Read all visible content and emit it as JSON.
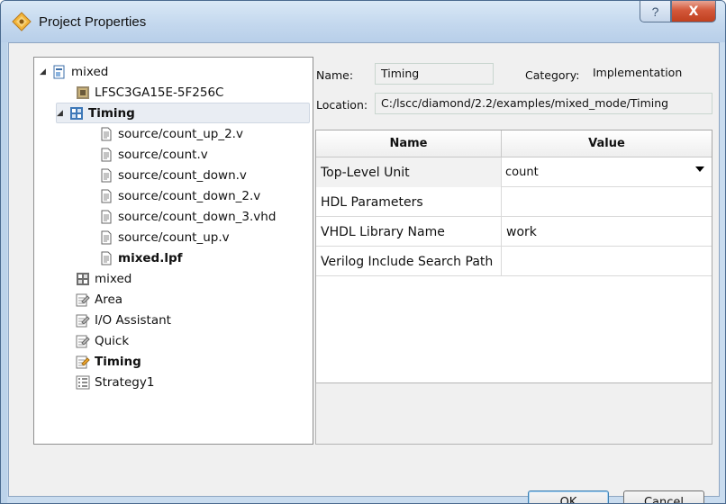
{
  "window": {
    "title": "Project Properties",
    "help_glyph": "?",
    "close_glyph": "X"
  },
  "tree": {
    "items": [
      {
        "label": "mixed",
        "icon": "project-icon",
        "bold": false
      },
      {
        "label": "LFSC3GA15E-5F256C",
        "icon": "device-chip-icon",
        "bold": false
      },
      {
        "label": "Timing",
        "icon": "implementation-icon",
        "bold": true,
        "selected": true
      },
      {
        "label": "source/count_up_2.v",
        "icon": "file-icon",
        "bold": false
      },
      {
        "label": "source/count.v",
        "icon": "file-icon",
        "bold": false
      },
      {
        "label": "source/count_down.v",
        "icon": "file-icon",
        "bold": false
      },
      {
        "label": "source/count_down_2.v",
        "icon": "file-icon",
        "bold": false
      },
      {
        "label": "source/count_down_3.vhd",
        "icon": "file-icon",
        "bold": false
      },
      {
        "label": "source/count_up.v",
        "icon": "file-icon",
        "bold": false
      },
      {
        "label": "mixed.lpf",
        "icon": "file-icon",
        "bold": true
      },
      {
        "label": "mixed",
        "icon": "implementation-icon",
        "bold": false
      },
      {
        "label": "Area",
        "icon": "strategy-icon",
        "bold": false
      },
      {
        "label": "I/O Assistant",
        "icon": "strategy-icon",
        "bold": false
      },
      {
        "label": "Quick",
        "icon": "strategy-icon",
        "bold": false
      },
      {
        "label": "Timing",
        "icon": "strategy-active-icon",
        "bold": true
      },
      {
        "label": "Strategy1",
        "icon": "strategy-list-icon",
        "bold": false
      }
    ]
  },
  "info": {
    "name_label": "Name:",
    "name_value": "Timing",
    "category_label": "Category:",
    "category_value": "Implementation",
    "location_label": "Location:",
    "location_value": "C:/lscc/diamond/2.2/examples/mixed_mode/Timing"
  },
  "grid": {
    "headers": [
      "Name",
      "Value"
    ],
    "rows": [
      {
        "name": "Top-Level Unit",
        "value": "count",
        "dropdown": true
      },
      {
        "name": "HDL Parameters",
        "value": ""
      },
      {
        "name": "VHDL Library Name",
        "value": "work"
      },
      {
        "name": "Verilog Include Search Path",
        "value": ""
      }
    ]
  },
  "buttons": {
    "ok": "OK",
    "cancel": "Cancel"
  }
}
